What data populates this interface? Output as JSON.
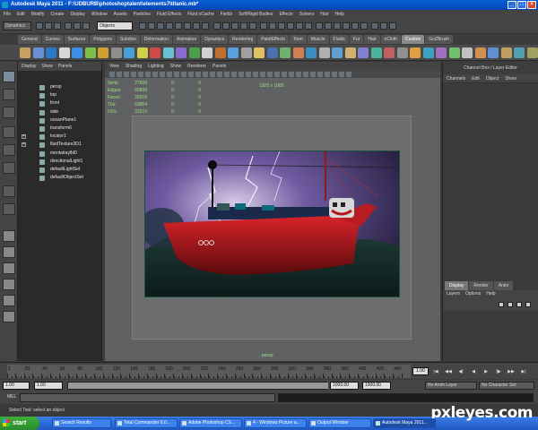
{
  "window": {
    "title": "Autodesk Maya 2011 - F:\\UDBURB\\photoshoptalent\\elements7\\titanic.mb*",
    "min": "_",
    "max": "□",
    "close": "×"
  },
  "menubar": [
    "File",
    "Edit",
    "Modify",
    "Create",
    "Display",
    "Window",
    "Assets",
    "Particles",
    "Fluid Effects",
    "Fluid nCache",
    "Fields",
    "Soft/Rigid Bodies",
    "Effects",
    "Solvers",
    "Hair",
    "Help"
  ],
  "statusline": {
    "mode": "Dynamics",
    "object_field": "Objects"
  },
  "shelf_tabs": [
    "General",
    "Curves",
    "Surfaces",
    "Polygons",
    "Subdivs",
    "Deformation",
    "Animation",
    "Dynamics",
    "Rendering",
    "PaintEffects",
    "Toon",
    "Muscle",
    "Fluids",
    "Fur",
    "Hair",
    "nCloth",
    "Custom",
    "GoZBrush"
  ],
  "shelf_active": "Custom",
  "outliner": {
    "menu": [
      "Display",
      "Show",
      "Panels"
    ],
    "items": [
      {
        "label": "persp",
        "expand": false
      },
      {
        "label": "top",
        "expand": false
      },
      {
        "label": "front",
        "expand": false
      },
      {
        "label": "side",
        "expand": false
      },
      {
        "label": "oceanPlane1",
        "expand": false
      },
      {
        "label": "transform6",
        "expand": false
      },
      {
        "label": "locator1",
        "expand": true
      },
      {
        "label": "fluidTexture3D1",
        "expand": true
      },
      {
        "label": "mentalraylbl0",
        "expand": false
      },
      {
        "label": "directionalLight1",
        "expand": false
      },
      {
        "label": "defaultLightSet",
        "expand": false
      },
      {
        "label": "defaultObjectSet",
        "expand": false
      }
    ]
  },
  "viewport": {
    "menu": [
      "View",
      "Shading",
      "Lighting",
      "Show",
      "Renderer",
      "Panels"
    ],
    "hud": [
      {
        "label": "Verts:",
        "value": "27609",
        "a": "0",
        "b": "0"
      },
      {
        "label": "Edges:",
        "value": "55899",
        "a": "0",
        "b": "0"
      },
      {
        "label": "Faces:",
        "value": "28316",
        "a": "0",
        "b": "0"
      },
      {
        "label": "Tris:",
        "value": "53864",
        "a": "0",
        "b": "0"
      },
      {
        "label": "UVs:",
        "value": "33210",
        "a": "0",
        "b": "0"
      }
    ],
    "resolution": "1920 x 1080",
    "camera": "persp"
  },
  "channelbox": {
    "title": "Channel Box / Layer Editor",
    "menu": [
      "Channels",
      "Edit",
      "Object",
      "Show"
    ]
  },
  "layereditor": {
    "tabs": [
      "Display",
      "Render",
      "Anim"
    ],
    "active_tab": "Display",
    "menu": [
      "Layers",
      "Options",
      "Help"
    ]
  },
  "timeslider": {
    "labels": [
      "1",
      "10",
      "20",
      "30",
      "40",
      "50",
      "60",
      "70",
      "80",
      "90",
      "100",
      "110",
      "120",
      "130",
      "140",
      "150",
      "160",
      "170",
      "180",
      "190",
      "200",
      "210",
      "220",
      "230",
      "240",
      "250",
      "260",
      "270",
      "280",
      "290",
      "300",
      "310",
      "320",
      "330",
      "340",
      "350",
      "360",
      "370",
      "380",
      "390",
      "400",
      "410",
      "420",
      "430",
      "440",
      "450"
    ],
    "current_frame": "1.00",
    "playback": [
      "|◀",
      "◀◀",
      "◀|",
      "◀",
      "▶",
      "|▶",
      "▶▶",
      "▶|"
    ]
  },
  "rangeslider": {
    "start": "1.00",
    "inner_start": "1.00",
    "inner_end": "1000.00",
    "end": "1000.00",
    "anim_layer": "No Anim Layer",
    "character_set": "No Character Set"
  },
  "cmdline": {
    "label": "MEL"
  },
  "helpline": "Select Tool: select an object",
  "taskbar": {
    "start": "start",
    "tasks": [
      {
        "label": "Search Results",
        "active": false
      },
      {
        "label": "Total Commander 6.0...",
        "active": false
      },
      {
        "label": "Adobe Photoshop CS...",
        "active": false
      },
      {
        "label": "4 - Windows Picture a...",
        "active": false
      },
      {
        "label": "Output Window",
        "active": false
      },
      {
        "label": "Autodesk Maya 2011...",
        "active": true
      }
    ],
    "logo": "pxleyes.com"
  }
}
